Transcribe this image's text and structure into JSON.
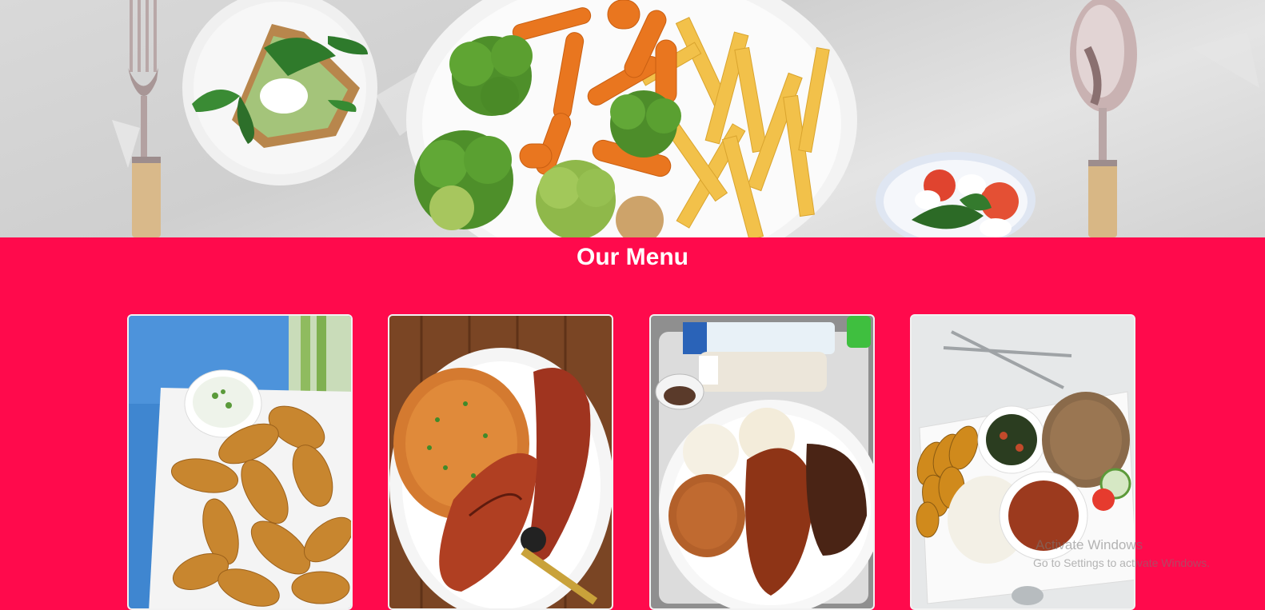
{
  "hero": {
    "icons": [
      "fork-icon",
      "spoon-icon"
    ],
    "dishes": [
      "avocado-toast-plate",
      "vegetables-and-fries-plate",
      "caprese-salad-plate"
    ]
  },
  "menu": {
    "title": "Our Menu",
    "items": [
      {
        "image": "chicken-wings-with-dip"
      },
      {
        "image": "jollof-rice-with-grilled-fish"
      },
      {
        "image": "rice-and-chicken-combo"
      },
      {
        "image": "plantain-rice-and-stew-platter"
      }
    ]
  },
  "watermark": {
    "line1": "Activate Windows",
    "line2": "Go to Settings to activate Windows."
  },
  "colors": {
    "accent": "#ff0a4c",
    "title_text": "#ffffff"
  }
}
